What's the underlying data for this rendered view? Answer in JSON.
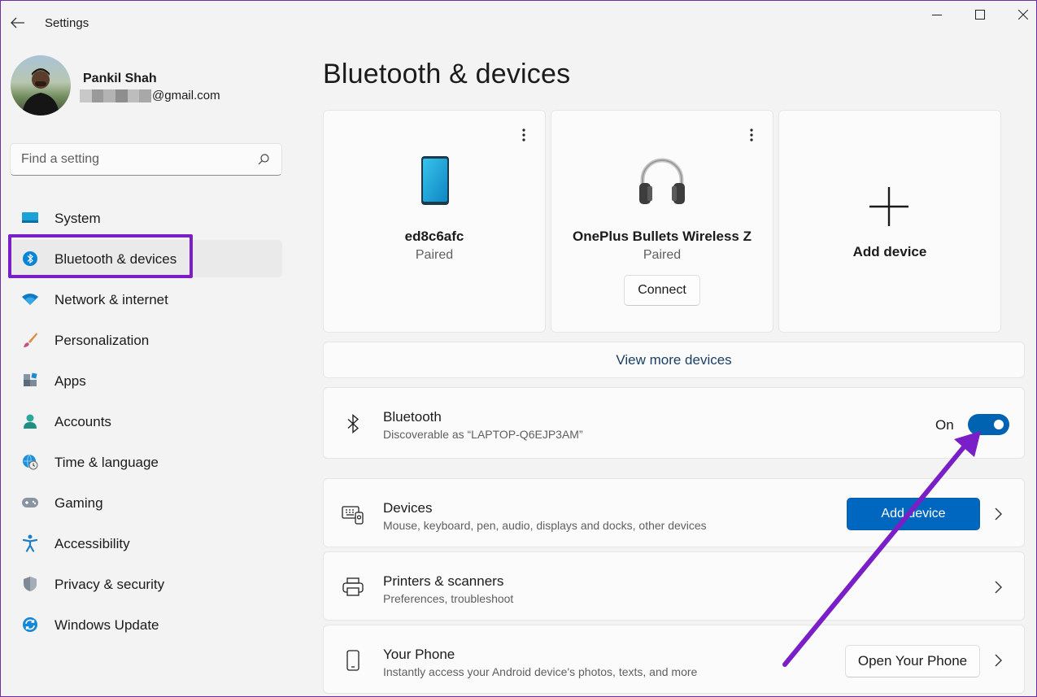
{
  "window": {
    "title": "Settings",
    "controls": [
      "minimize",
      "maximize",
      "close"
    ]
  },
  "profile": {
    "name": "Pankil Shah",
    "email_suffix": "@gmail.com",
    "email_redaction_colors": [
      "#c8c8c8",
      "#9a9a9a",
      "#b3b3b3",
      "#8e8e8e",
      "#bdbdbd",
      "#a8a8a8"
    ]
  },
  "search": {
    "placeholder": "Find a setting"
  },
  "sidebar": {
    "items": [
      {
        "label": "System",
        "icon": "monitor-icon"
      },
      {
        "label": "Bluetooth & devices",
        "icon": "bluetooth-icon",
        "active": true
      },
      {
        "label": "Network & internet",
        "icon": "wifi-icon"
      },
      {
        "label": "Personalization",
        "icon": "brush-icon"
      },
      {
        "label": "Apps",
        "icon": "apps-icon"
      },
      {
        "label": "Accounts",
        "icon": "person-icon"
      },
      {
        "label": "Time & language",
        "icon": "globe-clock-icon"
      },
      {
        "label": "Gaming",
        "icon": "gamepad-icon"
      },
      {
        "label": "Accessibility",
        "icon": "accessibility-icon"
      },
      {
        "label": "Privacy & security",
        "icon": "shield-icon"
      },
      {
        "label": "Windows Update",
        "icon": "update-icon"
      }
    ]
  },
  "main": {
    "title": "Bluetooth & devices",
    "devices": [
      {
        "name": "ed8c6afc",
        "status": "Paired",
        "icon": "phone-icon"
      },
      {
        "name": "OnePlus Bullets Wireless Z",
        "status": "Paired",
        "icon": "headphones-icon",
        "action": "Connect"
      }
    ],
    "add_device_card": {
      "label": "Add device"
    },
    "view_more": "View more devices",
    "bluetooth": {
      "title": "Bluetooth",
      "subtitle": "Discoverable as “LAPTOP-Q6EJP3AM”",
      "toggle_label": "On",
      "enabled": true
    },
    "rows": [
      {
        "title": "Devices",
        "subtitle": "Mouse, keyboard, pen, audio, displays and docks, other devices",
        "button": "Add device",
        "icon": "devices-icon"
      },
      {
        "title": "Printers & scanners",
        "subtitle": "Preferences, troubleshoot",
        "icon": "printer-icon"
      },
      {
        "title": "Your Phone",
        "subtitle": "Instantly access your Android device's photos, texts, and more",
        "button": "Open Your Phone",
        "icon": "phone-outline-icon"
      }
    ]
  },
  "colors": {
    "accent": "#0067c0",
    "annotation": "#7a1fc7",
    "background": "#f3f3f3"
  }
}
